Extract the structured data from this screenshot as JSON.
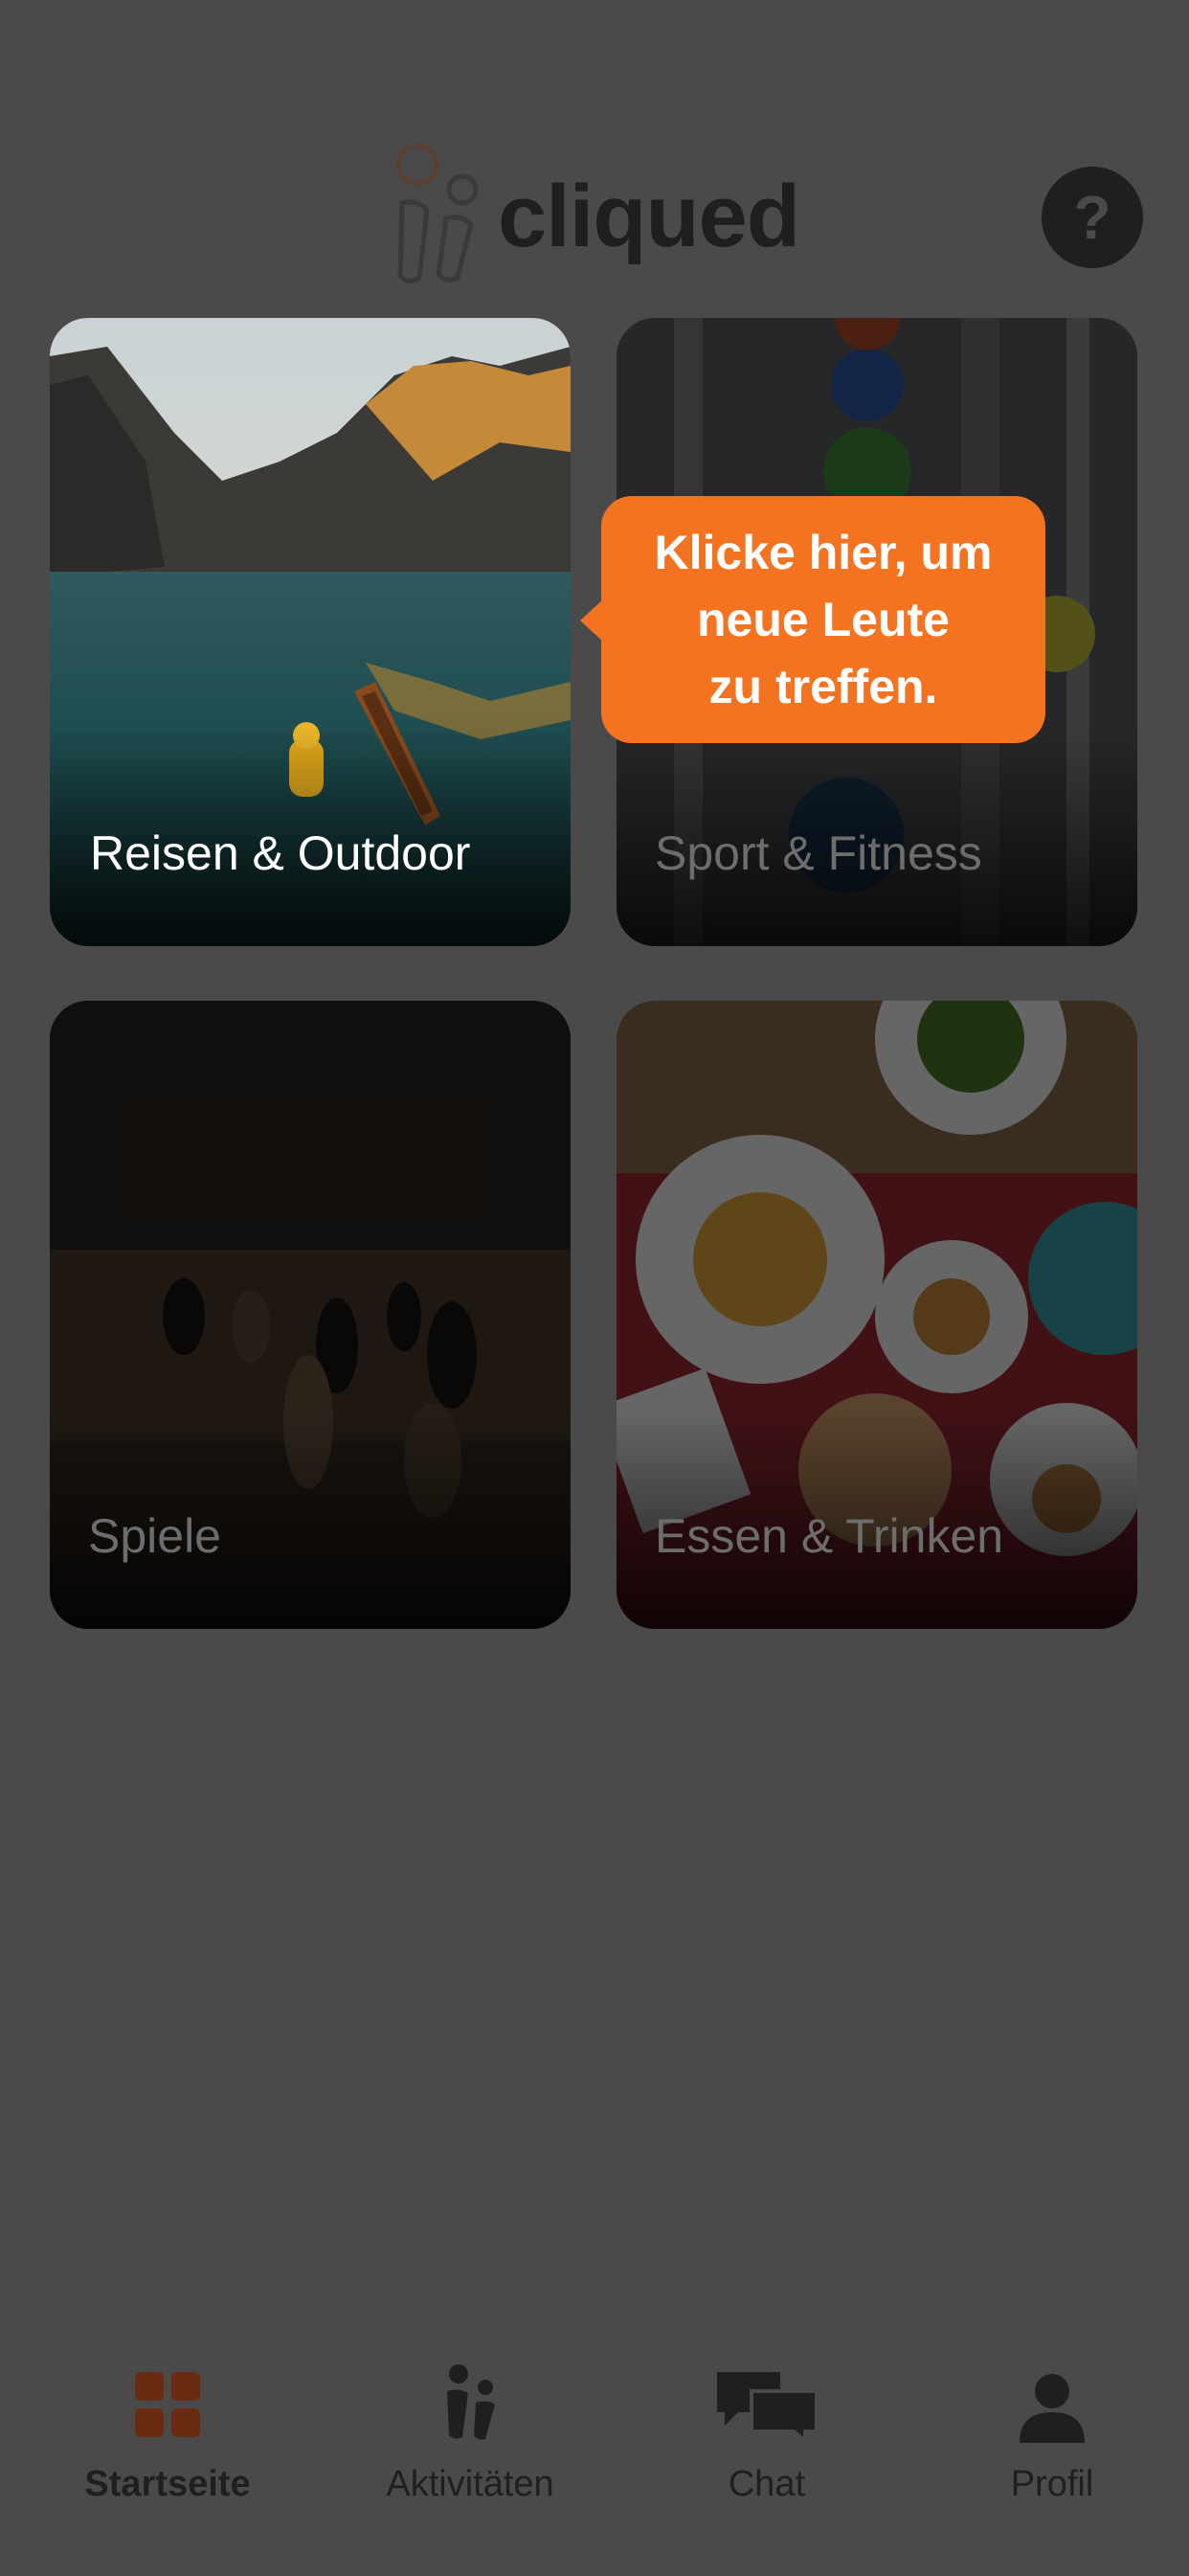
{
  "app": {
    "logo_text": "cliqued",
    "help_label": "?"
  },
  "categories": [
    {
      "label": "Reisen & Outdoor"
    },
    {
      "label": "Sport & Fitness"
    },
    {
      "label": "Spiele"
    },
    {
      "label": "Essen & Trinken"
    }
  ],
  "tooltip": {
    "text": "Klicke hier, um\nneue Leute\nzu treffen."
  },
  "tabs": [
    {
      "label": "Startseite",
      "icon": "grid-icon"
    },
    {
      "label": "Aktivitäten",
      "icon": "people-icon"
    },
    {
      "label": "Chat",
      "icon": "chat-bubbles-icon"
    },
    {
      "label": "Profil",
      "icon": "person-icon"
    }
  ],
  "colors": {
    "accent": "#f47321",
    "overlay": "#4a4a4a",
    "dark": "#1f1f1f",
    "selected_tab_icon": "#6b2b12"
  }
}
